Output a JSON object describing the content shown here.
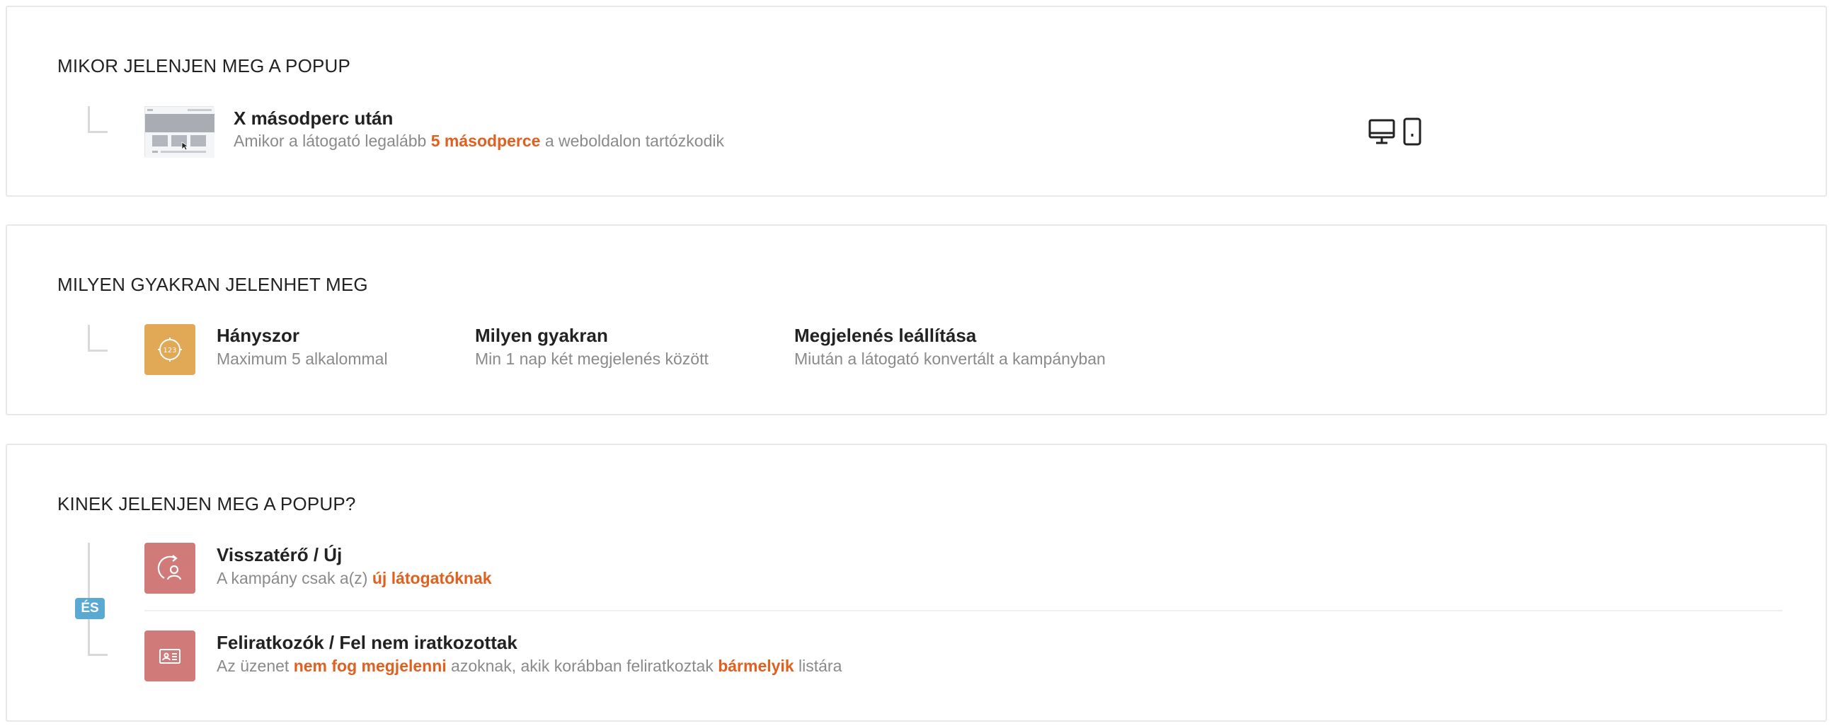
{
  "when": {
    "title": "MIKOR JELENJEN MEG A POPUP",
    "item": {
      "icon": "page-preview-thumbnail",
      "title": "X másodperc után",
      "desc_before": "Amikor a látogató legalább ",
      "desc_highlight": "5 másodperce",
      "desc_after": " a weboldalon tartózkodik"
    },
    "devices": [
      "desktop-icon",
      "mobile-icon"
    ]
  },
  "frequency": {
    "title": "MILYEN GYAKRAN JELENHET MEG",
    "icon": "counter-123-icon",
    "columns": [
      {
        "title": "Hányszor",
        "desc": "Maximum 5 alkalommal"
      },
      {
        "title": "Milyen gyakran",
        "desc": "Min 1 nap két megjelenés között"
      },
      {
        "title": "Megjelenés leállítása",
        "desc": "Miután a látogató konvertált a kampányban"
      }
    ]
  },
  "audience": {
    "title": "KINEK JELENJEN MEG A POPUP?",
    "operator": "ÉS",
    "items": [
      {
        "icon": "returning-visitor-icon",
        "title": "Visszatérő / Új",
        "desc_before": "A kampány csak a(z) ",
        "desc_highlight": "új látogatóknak",
        "desc_after": ""
      },
      {
        "icon": "subscriber-card-icon",
        "title": "Feliratkozók / Fel nem iratkozottak",
        "desc_before": "Az üzenet ",
        "desc_highlight": "nem fog megjelenni",
        "desc_middle": " azoknak, akik korábban feliratkoztak ",
        "desc_highlight2": "bármelyik",
        "desc_after": " listára"
      }
    ]
  },
  "colors": {
    "highlight": "#e0601f",
    "orange_tile": "#e1a855",
    "rose_tile": "#d07a7a",
    "and_badge": "#59a9d2"
  }
}
